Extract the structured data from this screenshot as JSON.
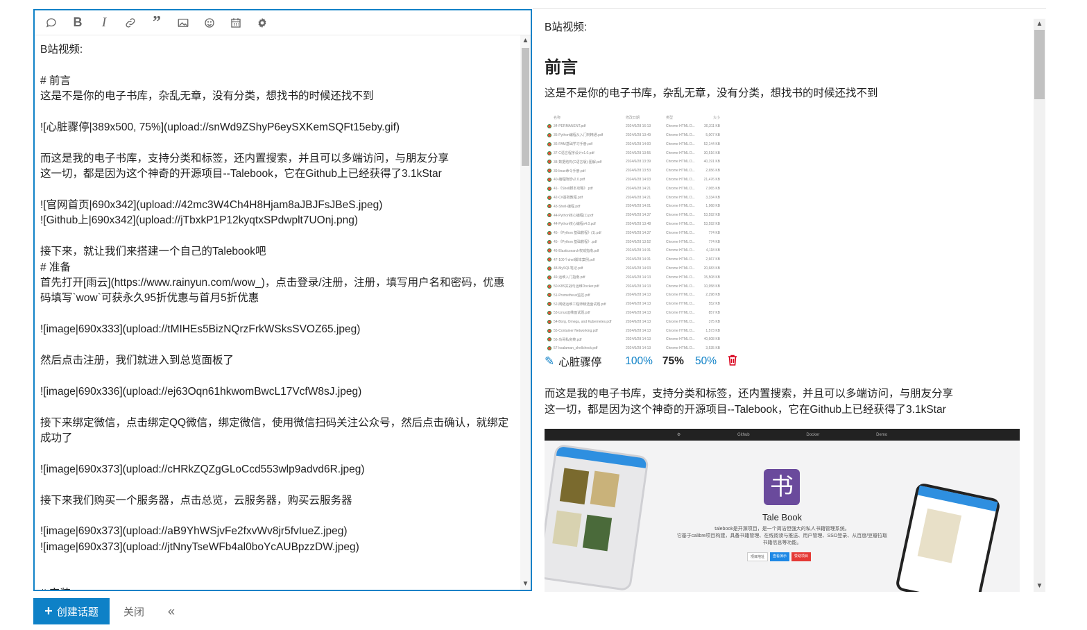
{
  "toolbar": {
    "buttons": [
      "quote-bubble",
      "bold",
      "italic",
      "link",
      "blockquote",
      "image",
      "emoji",
      "calendar",
      "gear"
    ]
  },
  "editor": {
    "lines": [
      "B站视频:",
      "",
      "# 前言",
      "这是不是你的电子书库，杂乱无章，没有分类，想找书的时候还找不到",
      "",
      "![心脏骤停|389x500, 75%](upload://snWd9ZShyP6eySXKemSQFt15eby.gif)",
      "",
      "而这是我的电子书库，支持分类和标签，还内置搜索，并且可以多端访问，与朋友分享",
      "这一切，都是因为这个神奇的开源项目--Talebook，它在Github上已经获得了3.1kStar",
      "",
      "![官网首页|690x342](upload://42mc3W4Ch4H8Hjam8aJBJFsJBeS.jpeg)",
      "![Github上|690x342](upload://jTbxkP1P12kyqtxSPdwplt7UOnj.png)",
      "",
      "接下来，就让我们来搭建一个自己的Talebook吧",
      "# 准备",
      "首先打开[雨云](https://www.rainyun.com/wow_)，点击登录/注册，注册，填写用户名和密码，优惠码填写`wow`可获永久95折优惠与首月5折优惠",
      "",
      "![image|690x333](upload://tMIHEs5BizNQrzFrkWSksSVOZ65.jpeg)",
      "",
      "然后点击注册，我们就进入到总览面板了",
      "",
      "![image|690x336](upload://ej63Oqn61hkwomBwcL17VcfW8sJ.jpeg)",
      "",
      "接下来绑定微信，点击绑定QQ微信，绑定微信，使用微信扫码关注公众号，然后点击确认，就绑定成功了",
      "",
      "![image|690x373](upload://cHRkZQZgGLoCcd553wlp9advd6R.jpeg)",
      "",
      "接下来我们购买一个服务器，点击总览，云服务器，购买云服务器",
      "",
      "![image|690x373](upload://aB9YhWSjvFe2fxvWv8jr5fvIueZ.jpeg)",
      "![image|690x373](upload://jtNnyTseWFb4al0boYcAUBpzzDW.jpeg)",
      "",
      "",
      "# 安装"
    ]
  },
  "preview": {
    "intro": "B站视频:",
    "heading": "前言",
    "para1": "这是不是你的电子书库，杂乱无章，没有分类，想找书的时候还找不到",
    "image_alt": "心脏骤停",
    "sizes": [
      "100%",
      "75%",
      "50%"
    ],
    "para2_line1": "而这是我的电子书库，支持分类和标签，还内置搜索，并且可以多端访问，与朋友分享",
    "para2_line2": "这一切，都是因为这个神奇的开源项目--Talebook，它在Github上已经获得了3.1kStar",
    "talebook": {
      "nav": [
        "Github",
        "Docker",
        "Demo"
      ],
      "logo_char": "书",
      "title": "Tale Book",
      "desc1": "talebook是开源项目，是一个简洁但强大的私人书籍管理系统。",
      "desc2": "它基于calibre项目构建，具备书籍管理、在线阅读与推送、用户管理、SSO登录、从百度/豆瓣拉取",
      "desc3": "书籍信息等功能。",
      "btn1": "项目地址",
      "btn2": "查看演示",
      "btn3": "赞助项目"
    },
    "filelist": {
      "headers": [
        "名称",
        "修改日期",
        "类型",
        "大小"
      ],
      "rows": [
        [
          "34-PERMANENT.pdf",
          "2024/6/28 16:13",
          "Chrome HTML D...",
          "30,311 KB"
        ],
        [
          "35-Python编程从入门到精通.pdf",
          "2024/6/28 13:49",
          "Chrome HTML D...",
          "5,007 KB"
        ],
        [
          "36-PAM基础学习手册.pdf",
          "2024/6/28 14:00",
          "Chrome HTML D...",
          "52,144 KB"
        ],
        [
          "37-C语言程序设计v1.0.pdf",
          "2024/6/28 13:55",
          "Chrome HTML D...",
          "30,516 KB"
        ],
        [
          "38-数据结构(C语言版)-图解.pdf",
          "2024/6/28 13:39",
          "Chrome HTML D...",
          "40,191 KB"
        ],
        [
          "39-linux命令手册.pdf",
          "2024/6/28 13:53",
          "Chrome HTML D...",
          "2,656 KB"
        ],
        [
          "40-编程随想v2.0.pdf",
          "2024/6/28 14:03",
          "Chrome HTML D...",
          "21,476 KB"
        ],
        [
          "41-《Shell脚本攻略》.pdf",
          "2024/6/28 14:21",
          "Chrome HTML D...",
          "7,065 KB"
        ],
        [
          "42-C#基础教程.pdf",
          "2024/6/28 14:21",
          "Chrome HTML D...",
          "3,334 KB"
        ],
        [
          "43-Shell-编程.pdf",
          "2024/6/28 14:01",
          "Chrome HTML D...",
          "1,968 KB"
        ],
        [
          "44-Python核心编程(1).pdf",
          "2024/6/28 14:37",
          "Chrome HTML D...",
          "53,592 KB"
        ],
        [
          "44-Python核心编程v4.0.pdf",
          "2024/6/28 13:48",
          "Chrome HTML D...",
          "53,592 KB"
        ],
        [
          "45-《Python 基础教程》(1).pdf",
          "2024/6/28 14:37",
          "Chrome HTML D...",
          "774 KB"
        ],
        [
          "45-《Python 基础教程》.pdf",
          "2024/6/28 13:52",
          "Chrome HTML D...",
          "774 KB"
        ],
        [
          "46-Elasticsearch权威指南.pdf",
          "2024/6/28 14:31",
          "Chrome HTML D...",
          "4,118 KB"
        ],
        [
          "47-100个shell脚本案例.pdf",
          "2024/6/28 14:31",
          "Chrome HTML D...",
          "2,667 KB"
        ],
        [
          "48-MySQL笔记.pdf",
          "2024/6/28 14:03",
          "Chrome HTML D...",
          "20,683 KB"
        ],
        [
          "49-运维入门指南.pdf",
          "2024/6/28 14:13",
          "Chrome HTML D...",
          "15,508 KB"
        ],
        [
          "50-K8S实战与运维Docker.pdf",
          "2024/6/28 14:13",
          "Chrome HTML D...",
          "10,958 KB"
        ],
        [
          "51-Prometheus监控.pdf",
          "2024/6/28 14:13",
          "Chrome HTML D...",
          "2,298 KB"
        ],
        [
          "52-网络运维工程师精选面试题.pdf",
          "2024/6/28 14:13",
          "Chrome HTML D...",
          "552 KB"
        ],
        [
          "53-Linux运维面试题.pdf",
          "2024/6/28 14:13",
          "Chrome HTML D...",
          "857 KB"
        ],
        [
          "54-Borg, Omega, and Kubernetes.pdf",
          "2024/6/28 14:13",
          "Chrome HTML D...",
          "375 KB"
        ],
        [
          "55-Container Networking.pdf",
          "2024/6/28 14:13",
          "Chrome HTML D...",
          "1,573 KB"
        ],
        [
          "56-鸟哥私房菜.pdf",
          "2024/6/28 14:13",
          "Chrome HTML D...",
          "40,608 KB"
        ],
        [
          "57-koalaman_shellcheck.pdf",
          "2024/6/28 14:13",
          "Chrome HTML D...",
          "3,535 KB"
        ]
      ]
    }
  },
  "footer": {
    "create_label": "创建话题",
    "close_label": "关闭",
    "collapse_label": "«"
  },
  "colors": {
    "accent": "#0e81c7",
    "danger": "#d9001b"
  }
}
